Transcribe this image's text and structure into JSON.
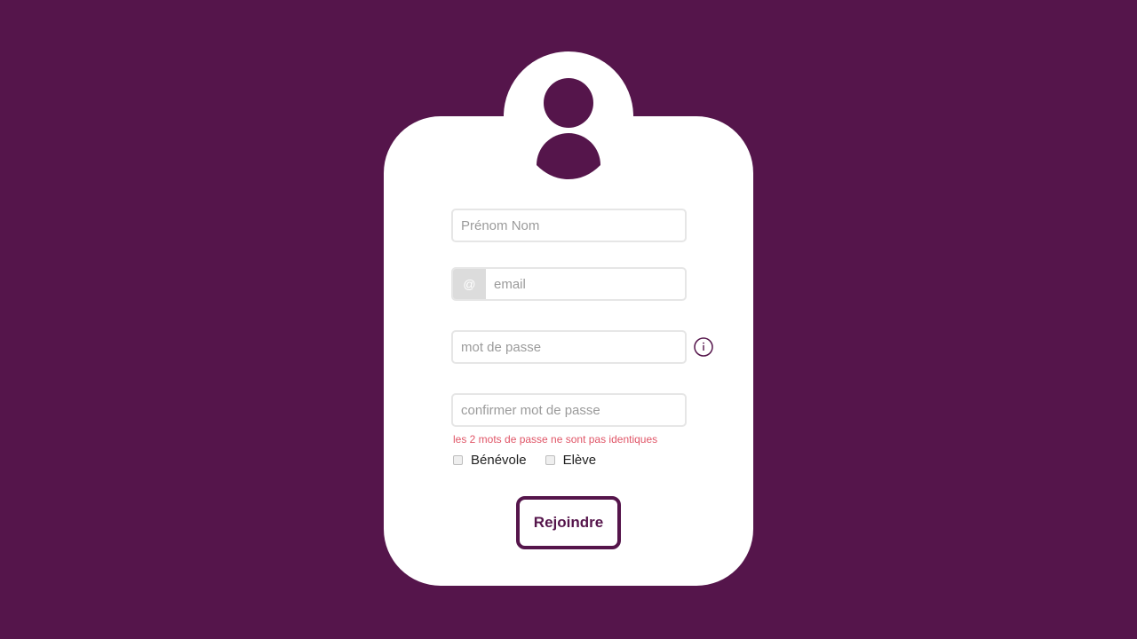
{
  "form": {
    "name_placeholder": "Prénom Nom",
    "email_prefix": "@",
    "email_placeholder": "email",
    "password_placeholder": "mot de passe",
    "confirm_placeholder": "confirmer mot de passe",
    "password_error": "les 2 mots de passe ne sont pas identiques",
    "checkboxes": [
      {
        "label": "Bénévole",
        "checked": false
      },
      {
        "label": "Elève",
        "checked": false
      }
    ],
    "submit_label": "Rejoindre"
  },
  "icons": {
    "avatar": "user-avatar-icon",
    "info": "info-icon"
  },
  "colors": {
    "background": "#55154b",
    "card": "#ffffff",
    "error": "#e05567"
  }
}
